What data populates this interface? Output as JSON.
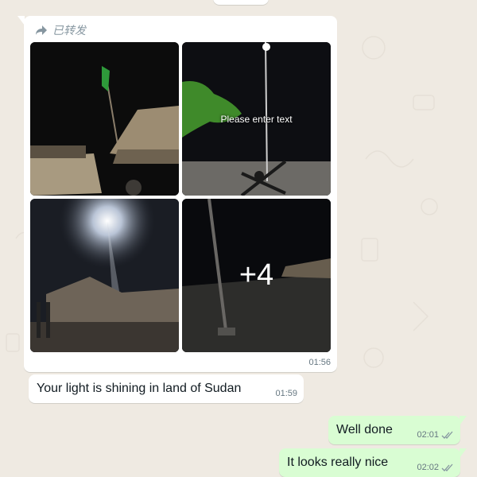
{
  "forwarded_label": "已转发",
  "media_message": {
    "tiles": [
      {
        "name": "photo-village-flag-hut"
      },
      {
        "name": "photo-tree-and-light-pole",
        "overlay_text": "Please enter text"
      },
      {
        "name": "photo-bright-street-light"
      },
      {
        "name": "photo-light-pole-ground",
        "more_count": "+4"
      }
    ],
    "time": "01:56"
  },
  "caption_message": {
    "text": "Your light is shining in land of Sudan",
    "time": "01:59"
  },
  "outgoing_messages": [
    {
      "text": "Well done",
      "time": "02:01",
      "status": "read"
    },
    {
      "text": "It looks really nice",
      "time": "02:02",
      "status": "read"
    }
  ],
  "colors": {
    "chat_background": "#efeae2",
    "incoming_bubble": "#ffffff",
    "outgoing_bubble": "#d9fdd3",
    "timestamp": "#667781",
    "forwarded_label": "#8696a0"
  }
}
